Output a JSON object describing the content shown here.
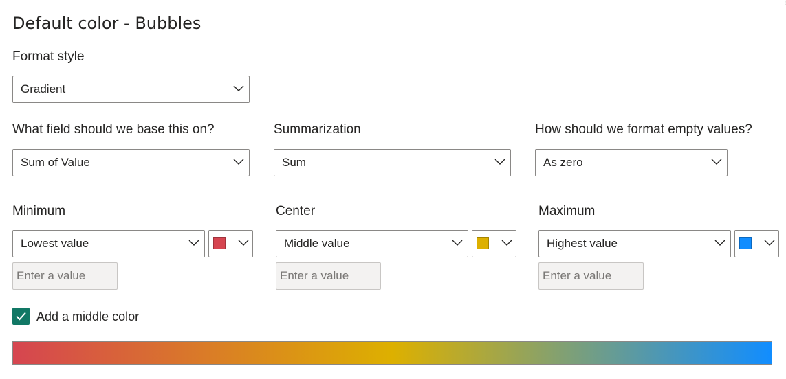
{
  "section_title": "Default color - Bubbles",
  "format_style": {
    "label": "Format style",
    "value": "Gradient"
  },
  "base_field": {
    "label": "What field should we base this on?",
    "value": "Sum of Value"
  },
  "summarization": {
    "label": "Summarization",
    "value": "Sum"
  },
  "empty_values": {
    "label": "How should we format empty values?",
    "value": "As zero"
  },
  "minimum": {
    "label": "Minimum",
    "value": "Lowest value",
    "color": "#d64550",
    "input_placeholder": "Enter a value"
  },
  "center": {
    "label": "Center",
    "value": "Middle value",
    "color": "#ddb000",
    "input_placeholder": "Enter a value"
  },
  "maximum": {
    "label": "Maximum",
    "value": "Highest value",
    "color": "#118dff",
    "input_placeholder": "Enter a value"
  },
  "middle_color": {
    "label": "Add a middle color",
    "checked": true,
    "accent": "#117865"
  },
  "icons": {
    "dropdown": "chevron-down-icon",
    "checkbox": "checkmark-icon"
  }
}
